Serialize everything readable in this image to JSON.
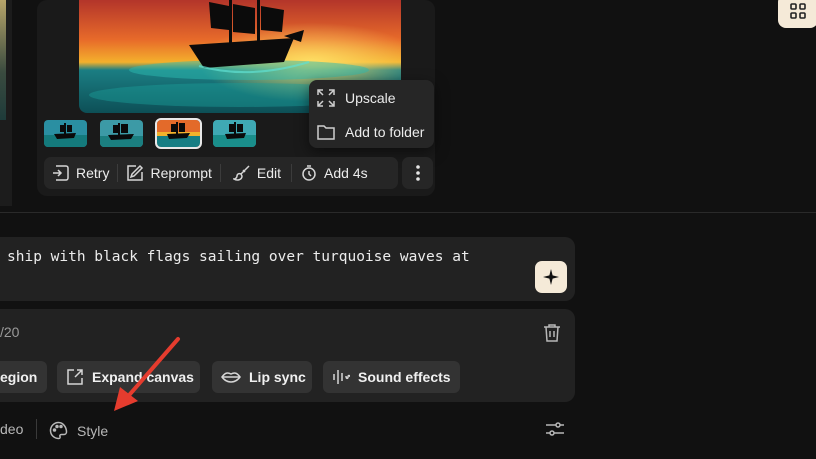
{
  "menu": {
    "items": [
      {
        "label": "Upscale",
        "icon": "expand-corners-icon"
      },
      {
        "label": "Add to folder",
        "icon": "folder-icon"
      }
    ]
  },
  "toolbar": {
    "retry_label": "Retry",
    "reprompt_label": "Reprompt",
    "edit_label": "Edit",
    "add4s_label": "Add 4s"
  },
  "prompt": {
    "text": "ship with black flags sailing over turquoise waves at"
  },
  "options": {
    "counter": "/20",
    "chips": [
      {
        "label": "egion",
        "icon": null
      },
      {
        "label": "Expand canvas",
        "icon": "expand-canvas-icon"
      },
      {
        "label": "Lip sync",
        "icon": "lips-icon"
      },
      {
        "label": "Sound effects",
        "icon": "sound-wave-icon"
      }
    ]
  },
  "bottom": {
    "video_label": "deo",
    "style_label": "Style"
  },
  "colors": {
    "accent_button": "#f5ead8",
    "annotation_arrow": "#e53c2e",
    "panel": "#222222",
    "background": "#111111"
  }
}
